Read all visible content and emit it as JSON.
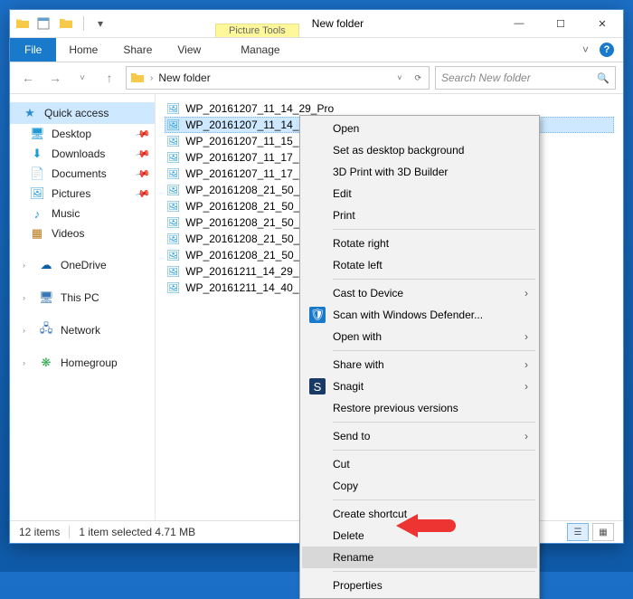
{
  "title": {
    "context_group": "Picture Tools",
    "context_tab": "Manage",
    "window_title": "New folder"
  },
  "ribbon": {
    "file": "File",
    "tabs": [
      "Home",
      "Share",
      "View"
    ],
    "context_tab": "Manage",
    "expand_glyph": "˅",
    "help_glyph": "?"
  },
  "nav_arrows": {
    "back": "←",
    "fwd": "→",
    "recent": "˅",
    "up": "↑"
  },
  "address": {
    "location": "New folder",
    "dropdown_glyph": "˅",
    "refresh_glyph": "⟳"
  },
  "search": {
    "placeholder": "Search New folder",
    "icon": "🔍"
  },
  "navpane": {
    "quick_access": "Quick access",
    "items": [
      {
        "label": "Desktop",
        "icon": "🖥",
        "color": "#1e9ad6",
        "pinned": true
      },
      {
        "label": "Downloads",
        "icon": "⬇",
        "color": "#1e9ad6",
        "pinned": true
      },
      {
        "label": "Documents",
        "icon": "📄",
        "color": "#6aa9e2",
        "pinned": true
      },
      {
        "label": "Pictures",
        "icon": "🖼",
        "color": "#35a0dc",
        "pinned": true
      },
      {
        "label": "Music",
        "icon": "♪",
        "color": "#1e9ad6",
        "pinned": false
      },
      {
        "label": "Videos",
        "icon": "▦",
        "color": "#b8791a",
        "pinned": false
      }
    ],
    "onedrive": {
      "label": "OneDrive",
      "icon": "☁",
      "color": "#0b5fa5"
    },
    "thispc": {
      "label": "This PC",
      "icon": "🖥",
      "color": "#3a78b5"
    },
    "network": {
      "label": "Network",
      "icon": "🖧",
      "color": "#3a78b5"
    },
    "homegroup": {
      "label": "Homegroup",
      "icon": "❋",
      "color": "#2aa84b"
    }
  },
  "files": [
    "WP_20161207_11_14_29_Pro",
    "WP_20161207_11_14_33_Pro",
    "WP_20161207_11_15_…",
    "WP_20161207_11_17_…",
    "WP_20161207_11_17_…",
    "WP_20161208_21_50_…",
    "WP_20161208_21_50_…",
    "WP_20161208_21_50_…",
    "WP_20161208_21_50_…",
    "WP_20161208_21_50_…",
    "WP_20161211_14_29_…",
    "WP_20161211_14_40_…"
  ],
  "selected_index": 1,
  "status": {
    "items": "12 items",
    "selection": "1 item selected  4.71 MB"
  },
  "context_menu": [
    {
      "label": "Open"
    },
    {
      "label": "Set as desktop background"
    },
    {
      "label": "3D Print with 3D Builder"
    },
    {
      "label": "Edit"
    },
    {
      "label": "Print"
    },
    {
      "sep": true
    },
    {
      "label": "Rotate right"
    },
    {
      "label": "Rotate left"
    },
    {
      "sep": true
    },
    {
      "label": "Cast to Device",
      "submenu": true
    },
    {
      "label": "Scan with Windows Defender...",
      "icon": "🛡",
      "icon_bg": "#1979ca",
      "icon_color": "#fff"
    },
    {
      "label": "Open with",
      "submenu": true
    },
    {
      "sep": true
    },
    {
      "label": "Share with",
      "submenu": true
    },
    {
      "label": "Snagit",
      "submenu": true,
      "icon": "S",
      "icon_bg": "#1a3a66",
      "icon_color": "#fff"
    },
    {
      "label": "Restore previous versions"
    },
    {
      "sep": true
    },
    {
      "label": "Send to",
      "submenu": true
    },
    {
      "sep": true
    },
    {
      "label": "Cut"
    },
    {
      "label": "Copy"
    },
    {
      "sep": true
    },
    {
      "label": "Create shortcut"
    },
    {
      "label": "Delete"
    },
    {
      "label": "Rename",
      "hover": true
    },
    {
      "sep": true
    },
    {
      "label": "Properties"
    }
  ]
}
